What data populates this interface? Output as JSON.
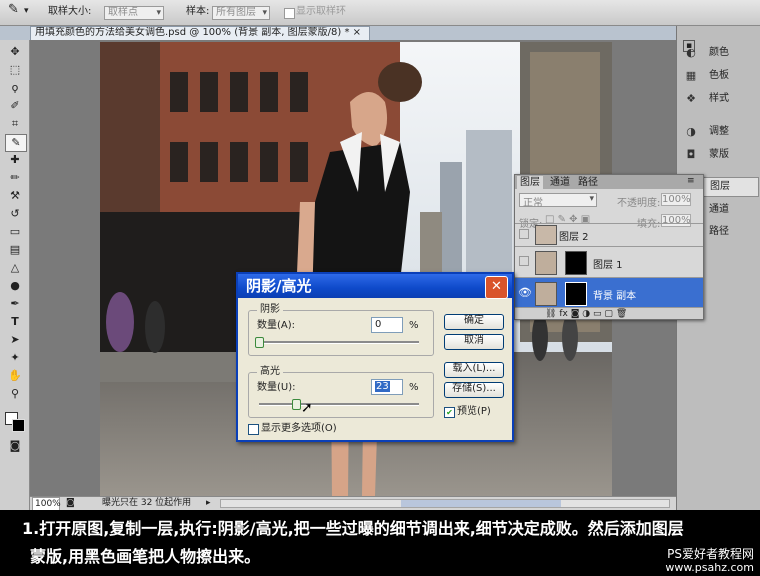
{
  "options_bar": {
    "sample_size_label": "取样大小:",
    "sample_size_value": "取样点",
    "sample_label": "样本:",
    "sample_value": "所有图层",
    "show_ring_label": "显示取样环"
  },
  "document": {
    "tab_title": "用填充颜色的方法给美女调色.psd @ 100% (背景 副本, 图层蒙版/8) * ×",
    "zoom": "100%",
    "status": "曝光只在 32 位起作用"
  },
  "dock": {
    "items": [
      {
        "label": "颜色",
        "icon": "palette-icon"
      },
      {
        "label": "色板",
        "icon": "swatches-icon"
      },
      {
        "label": "样式",
        "icon": "styles-icon"
      },
      {
        "label": "调整",
        "icon": "adjustments-icon"
      },
      {
        "label": "蒙版",
        "icon": "masks-icon"
      },
      {
        "label": "图层",
        "icon": "layers-icon"
      },
      {
        "label": "通道",
        "icon": "channels-icon"
      },
      {
        "label": "路径",
        "icon": "paths-icon"
      }
    ]
  },
  "layers_panel": {
    "tabs": [
      "图层",
      "通道",
      "路径"
    ],
    "blend_mode": "正常",
    "opacity_label": "不透明度:",
    "opacity_value": "100%",
    "lock_label": "锁定:",
    "fill_label": "填充:",
    "fill_value": "100%",
    "layers": [
      {
        "name": "图层 2"
      },
      {
        "name": "图层 1"
      },
      {
        "name": "背景 副本",
        "selected": true
      }
    ]
  },
  "dialog": {
    "title": "阴影/高光",
    "shadows_group": "阴影",
    "amount_label": "数量(A):",
    "shadows_amount": "0",
    "percent": "%",
    "highlights_group": "高光",
    "highlights_amount_label": "数量(U):",
    "highlights_amount": "23",
    "highlights_level": 0.23,
    "shadows_level": 0.0,
    "more_options_label": "显示更多选项(O)",
    "ok_label": "确定",
    "cancel_label": "取消",
    "load_label": "载入(L)...",
    "save_label": "存储(S)...",
    "preview_label": "预览(P)"
  },
  "caption": {
    "line1": "1.打开原图,复制一层,执行:阴影/高光,把一些过曝的细节调出来,细节决定成败。然后添加图层",
    "line2": "蒙版,用黑色画笔把人物擦出来。"
  },
  "watermark": {
    "line1": "PS爱好者教程网",
    "line2": "www.psahz.com"
  },
  "colors": {
    "titlebar": "#0e49c9",
    "selected_layer": "#3a6fd0",
    "dialog_bg": "#ece9d8"
  }
}
